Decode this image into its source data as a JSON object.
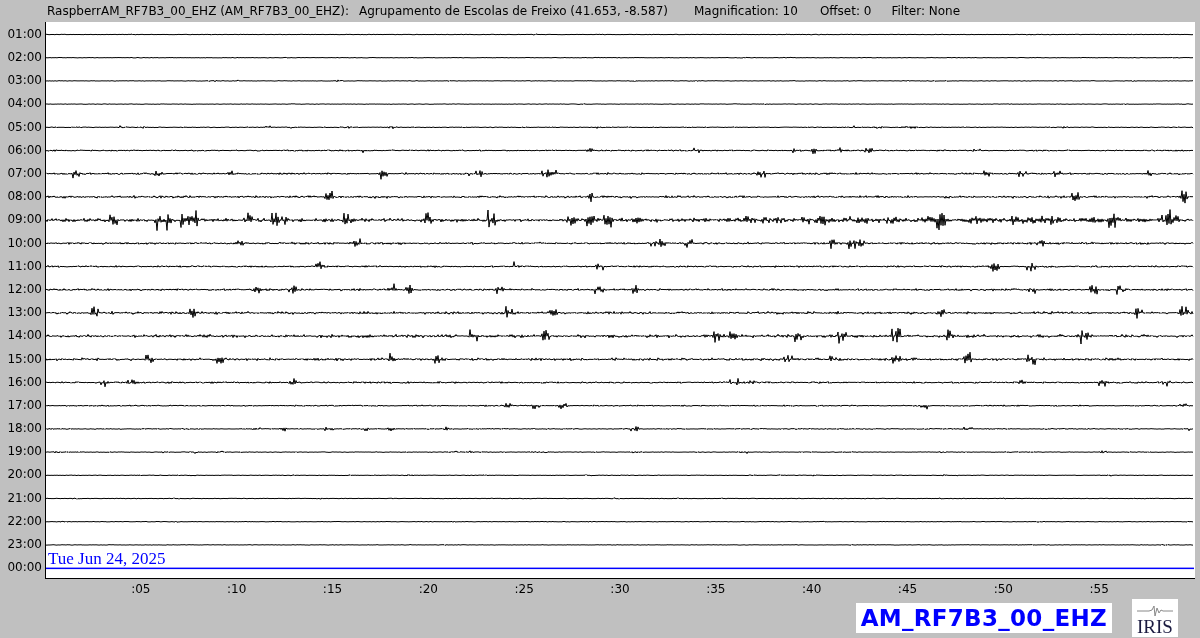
{
  "header": {
    "station": "RaspberrAM_RF7B3_00_EHZ (AM_RF7B3_00_EHZ):",
    "location": "Agrupamento de Escolas de Freixo (41.653, -8.587)",
    "magnification": "Magnification: 10",
    "offset": "Offset: 0",
    "filter": "Filter: None"
  },
  "rows": [
    {
      "label": "01:00",
      "current": false
    },
    {
      "label": "02:00",
      "current": false
    },
    {
      "label": "03:00",
      "current": false
    },
    {
      "label": "04:00",
      "current": false
    },
    {
      "label": "05:00",
      "current": false
    },
    {
      "label": "06:00",
      "current": false
    },
    {
      "label": "07:00",
      "current": false
    },
    {
      "label": "08:00",
      "current": false
    },
    {
      "label": "09:00",
      "current": false
    },
    {
      "label": "10:00",
      "current": false
    },
    {
      "label": "11:00",
      "current": false
    },
    {
      "label": "12:00",
      "current": false
    },
    {
      "label": "13:00",
      "current": false
    },
    {
      "label": "14:00",
      "current": false
    },
    {
      "label": "15:00",
      "current": false
    },
    {
      "label": "16:00",
      "current": false
    },
    {
      "label": "17:00",
      "current": false
    },
    {
      "label": "18:00",
      "current": false
    },
    {
      "label": "19:00",
      "current": false
    },
    {
      "label": "20:00",
      "current": false
    },
    {
      "label": "21:00",
      "current": false
    },
    {
      "label": "22:00",
      "current": false
    },
    {
      "label": "23:00",
      "current": false
    },
    {
      "label": "00:00",
      "current": true
    }
  ],
  "date": "Tue Jun 24, 2025",
  "x_ticks": [
    ":05",
    ":10",
    ":15",
    ":20",
    ":25",
    ":30",
    ":35",
    ":40",
    ":45",
    ":50",
    ":55"
  ],
  "channel_label": "AM_RF7B3_00_EHZ",
  "logo_text": "IRIS"
}
